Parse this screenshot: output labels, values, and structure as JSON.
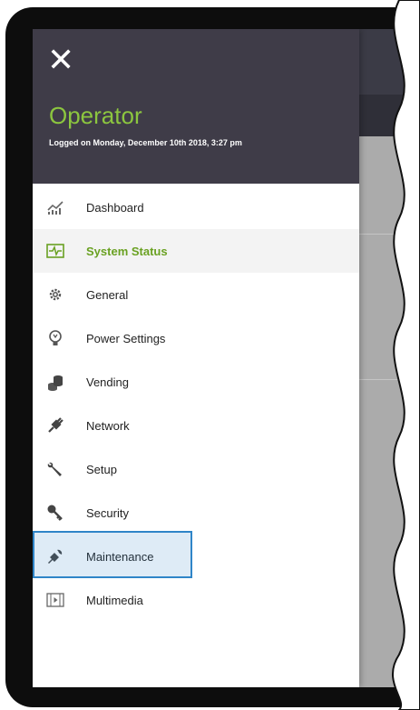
{
  "drawer": {
    "close_icon": "close-icon",
    "role": "Operator",
    "login_info": "Logged on Monday, December 10th 2018, 3:27 pm"
  },
  "menu": {
    "items": [
      {
        "label": "Dashboard",
        "icon": "chart-icon"
      },
      {
        "label": "System Status",
        "icon": "pulse-icon",
        "active": true
      },
      {
        "label": "General",
        "icon": "gear-icon"
      },
      {
        "label": "Power Settings",
        "icon": "bulb-icon"
      },
      {
        "label": "Vending",
        "icon": "coins-icon"
      },
      {
        "label": "Network",
        "icon": "plug-icon"
      },
      {
        "label": "Setup",
        "icon": "wrench-icon"
      },
      {
        "label": "Security",
        "icon": "key-icon"
      },
      {
        "label": "Maintenance",
        "icon": "plug-wrench-icon",
        "highlighted": true
      },
      {
        "label": "Multimedia",
        "icon": "film-icon"
      }
    ]
  },
  "colors": {
    "header_bg": "#3f3c48",
    "accent_green": "#8cc63f",
    "highlight_blue": "#2f85c8"
  }
}
